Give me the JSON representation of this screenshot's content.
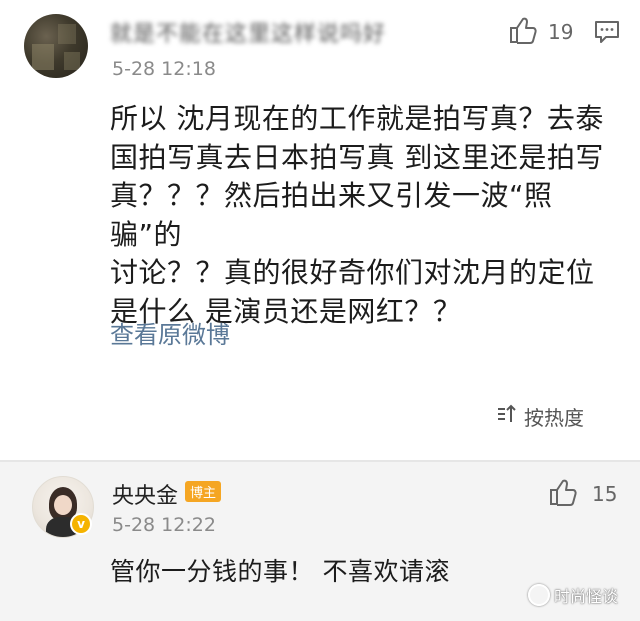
{
  "comment": {
    "username": "就是不能在这里这样说吗好",
    "timestamp": "5-28 12:18",
    "likes": "19",
    "content": "所以 沈月现在的工作就是拍写真？去泰\n国拍写真去日本拍写真 到这里还是拍写\n真？？？然后拍出来又引发一波“照骗”的\n讨论？？真的很好奇你们对沈月的定位\n是什么 是演员还是网红？？",
    "view_original": "查看原微博"
  },
  "sort": {
    "label": "按热度"
  },
  "reply": {
    "username": "央央金",
    "badge": "博主",
    "timestamp": "5-28 12:22",
    "likes": "15",
    "content": "管你一分钱的事！ 不喜欢请滚"
  },
  "watermark": {
    "text": "时尚怪谈"
  },
  "colors": {
    "link": "#5a7897",
    "badge": "#f5a623",
    "verified": "#f5b300"
  }
}
